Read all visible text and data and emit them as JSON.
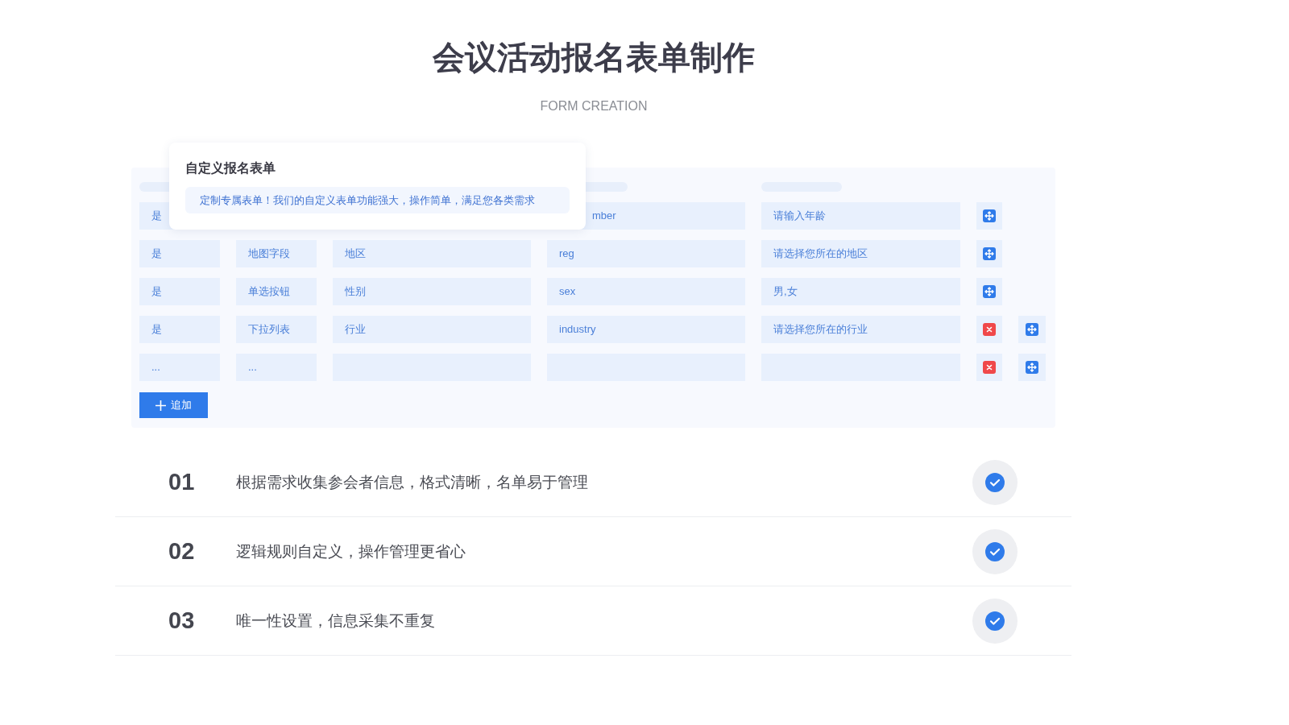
{
  "title": "会议活动报名表单制作",
  "subtitle": "FORM CREATION",
  "form_editor": {
    "popover": {
      "title": "自定义报名表单",
      "description": "定制专属表单！我们的自定义表单功能强大，操作简单，满足您各类需求"
    },
    "rows": [
      {
        "required": "是",
        "field": "mber",
        "hint": "请输入年龄",
        "deletable": false
      },
      {
        "required": "是",
        "type": "地图字段",
        "label": "地区",
        "field": "reg",
        "hint": "请选择您所在的地区",
        "deletable": false
      },
      {
        "required": "是",
        "type": "单选按钮",
        "label": "性别",
        "field": "sex",
        "hint": "男,女",
        "deletable": false
      },
      {
        "required": "是",
        "type": "下拉列表",
        "label": "行业",
        "field": "industry",
        "hint": "请选择您所在的行业",
        "deletable": true
      },
      {
        "required": "...",
        "type": "...",
        "deletable": true
      }
    ],
    "add_button": "追加"
  },
  "features": [
    {
      "number": "01",
      "text": "根据需求收集参会者信息，格式清晰，名单易于管理",
      "checked": true
    },
    {
      "number": "02",
      "text": "逻辑规则自定义，操作管理更省心",
      "checked": true
    },
    {
      "number": "03",
      "text": "唯一性设置，信息采集不重复",
      "checked": true
    }
  ]
}
